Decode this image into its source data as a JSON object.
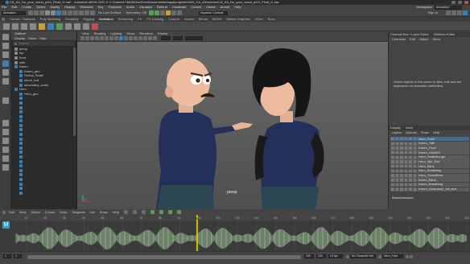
{
  "window": {
    "title": "CA_A3_Do_your_worst_pt10_Final_r1.ma* - Autodesk MAYA 2022.3: C:\\Users\\174826\\OneDrive\\Documents\\maya\\projects\\2020_CA_A3\\scenes\\CA_A3_Do_your_worst_pt10_Final_r1.ma"
  },
  "menubar": {
    "items": [
      "File",
      "Edit",
      "Create",
      "Select",
      "Modify",
      "Display",
      "Windows",
      "Key",
      "Playback",
      "Audio",
      "Visualize",
      "Deform",
      "Constrain",
      "Control",
      "Cache",
      "Arnold",
      "Help"
    ],
    "workspace_label": "Workspace:",
    "workspace_value": "Animation*"
  },
  "statusline": {
    "mode": "Animation",
    "live_surface": "No Live Surface",
    "symmetry": "Symmetry: Off",
    "signin": "Sign In",
    "camera_controls": "Inspector Controls"
  },
  "shelf": {
    "tabs": [
      "Curves / Surfaces",
      "Poly Modeling",
      "Sculpting",
      "Rigging",
      "Animation",
      "Rendering",
      "FX",
      "FX Caching",
      "Custom",
      "Arnold",
      "Bifrost",
      "MASH",
      "Motion Graphics",
      "XGen",
      "Boss"
    ],
    "active": "Animation"
  },
  "outliner": {
    "title": "Outliner",
    "menus": [
      "Display",
      "Show",
      "Help"
    ],
    "search_placeholder": "Search...",
    "items": [
      "persp",
      "top",
      "front",
      "side",
      "Karen",
      "Karen_geo",
      "Global_Scale",
      "shoot_null",
      "secondary_scale",
      "Hero",
      "Hero_geo",
      "",
      "",
      "",
      "",
      "",
      "",
      "",
      "",
      "",
      "",
      "",
      "",
      "",
      "",
      "",
      "",
      "",
      "",
      "",
      "",
      "",
      ""
    ]
  },
  "viewport": {
    "menus": [
      "View",
      "Shading",
      "Lighting",
      "Show",
      "Renderer",
      "Panels"
    ],
    "camera_label": "persp"
  },
  "channelbox": {
    "tabs": [
      "Channel Box / Layer Editor",
      "Attribute Editor"
    ],
    "menus": [
      "Channels",
      "Edit",
      "Object",
      "Show"
    ],
    "message": "Select objects in the scene to view, edit and set keyframes on channels (attributes)."
  },
  "anim_layers": {
    "tabs": [
      "Display",
      "Anim"
    ],
    "menus": [
      "Layers",
      "Options",
      "Show",
      "Help"
    ],
    "layers": [
      "Hero_Face",
      "Karen_Talk",
      "Karen_Face",
      "Karen_HANDS",
      "Hero_Walkthrough",
      "Hero_Idle_Exit",
      "Hero_Blink",
      "Hero_Breathing",
      "Hero_Transitions",
      "Karen_Blink",
      "Karen_Breathing",
      "Karen_Gestures2_full_text"
    ],
    "base_label": "BaseAnimation"
  },
  "graph": {
    "menus": [
      "Edit",
      "View",
      "Select",
      "Curves",
      "Keys",
      "Tangents",
      "List",
      "Show",
      "Help"
    ]
  },
  "range": {
    "start": "1",
    "playback_start": "1",
    "playback_end": "240",
    "end": "240",
    "fps": "24 fps",
    "character_set": "No Character Set",
    "anim_layer": "Hero_Face",
    "current_frame": "99",
    "ticks": [
      "10",
      "20",
      "30",
      "40",
      "50",
      "60",
      "70",
      "80",
      "90",
      "100",
      "110",
      "120",
      "130",
      "140",
      "150",
      "160",
      "170",
      "180",
      "190",
      "200",
      "210",
      "220",
      "230",
      "240"
    ]
  },
  "colors": {
    "accent": "#4a6a8a",
    "playhead": "#d6c000",
    "waveform": "#8fae8a"
  }
}
